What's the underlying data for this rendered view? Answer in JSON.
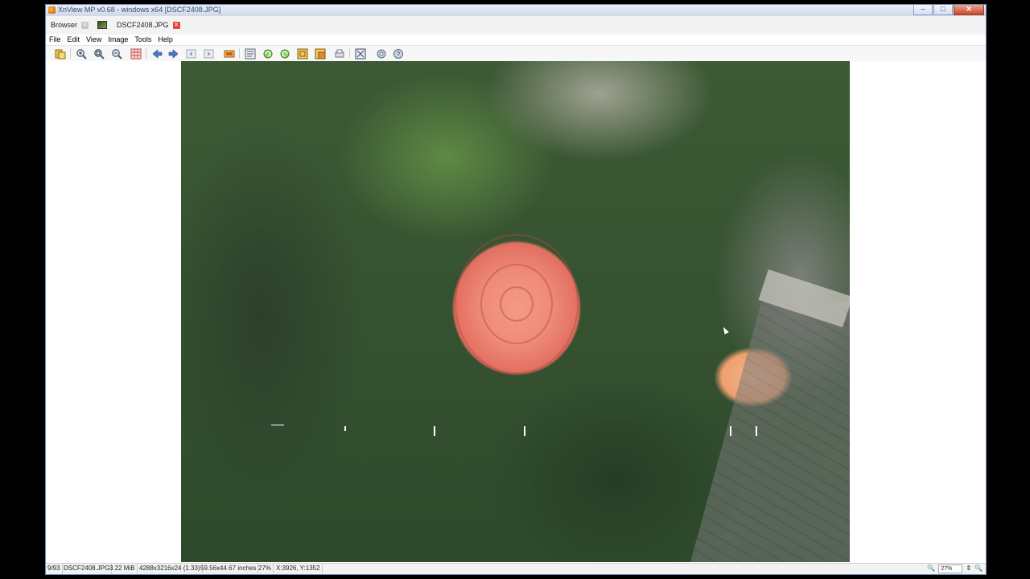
{
  "window": {
    "title": "XnView MP v0.68 - windows x64 [DSCF2408.JPG]",
    "controls": {
      "minimize": "–",
      "maximize": "□",
      "close": "✕"
    }
  },
  "tabs": [
    {
      "label": "Browser",
      "active": false
    },
    {
      "label": "DSCF2408.JPG",
      "active": true
    }
  ],
  "menu": [
    "File",
    "Edit",
    "View",
    "Image",
    "Tools",
    "Help"
  ],
  "toolbar": {
    "icons": [
      "browser-icon",
      "zoom-in-icon",
      "zoom-fit-icon",
      "zoom-out-icon",
      "grid-icon",
      "previous-icon",
      "next-icon",
      "first-page-icon",
      "last-page-icon",
      "slideshow-icon",
      "properties-icon",
      "rotate-left-icon",
      "rotate-right-icon",
      "crop-icon",
      "resize-icon",
      "print-icon",
      "fullscreen-icon",
      "settings-icon",
      "help-icon"
    ]
  },
  "viewer": {
    "image_description_alt": "DSCF2408.JPG"
  },
  "status": {
    "index": "9/93",
    "filename": "DSCF2408.JPG",
    "filesize": "3.22 MiB",
    "dimensions": "4288x3216x24 (1.33)",
    "print_size": "59.56x44.67 inches",
    "zoom": "27%",
    "coords": "X:3926, Y:1352",
    "zoom_box": "27%"
  }
}
